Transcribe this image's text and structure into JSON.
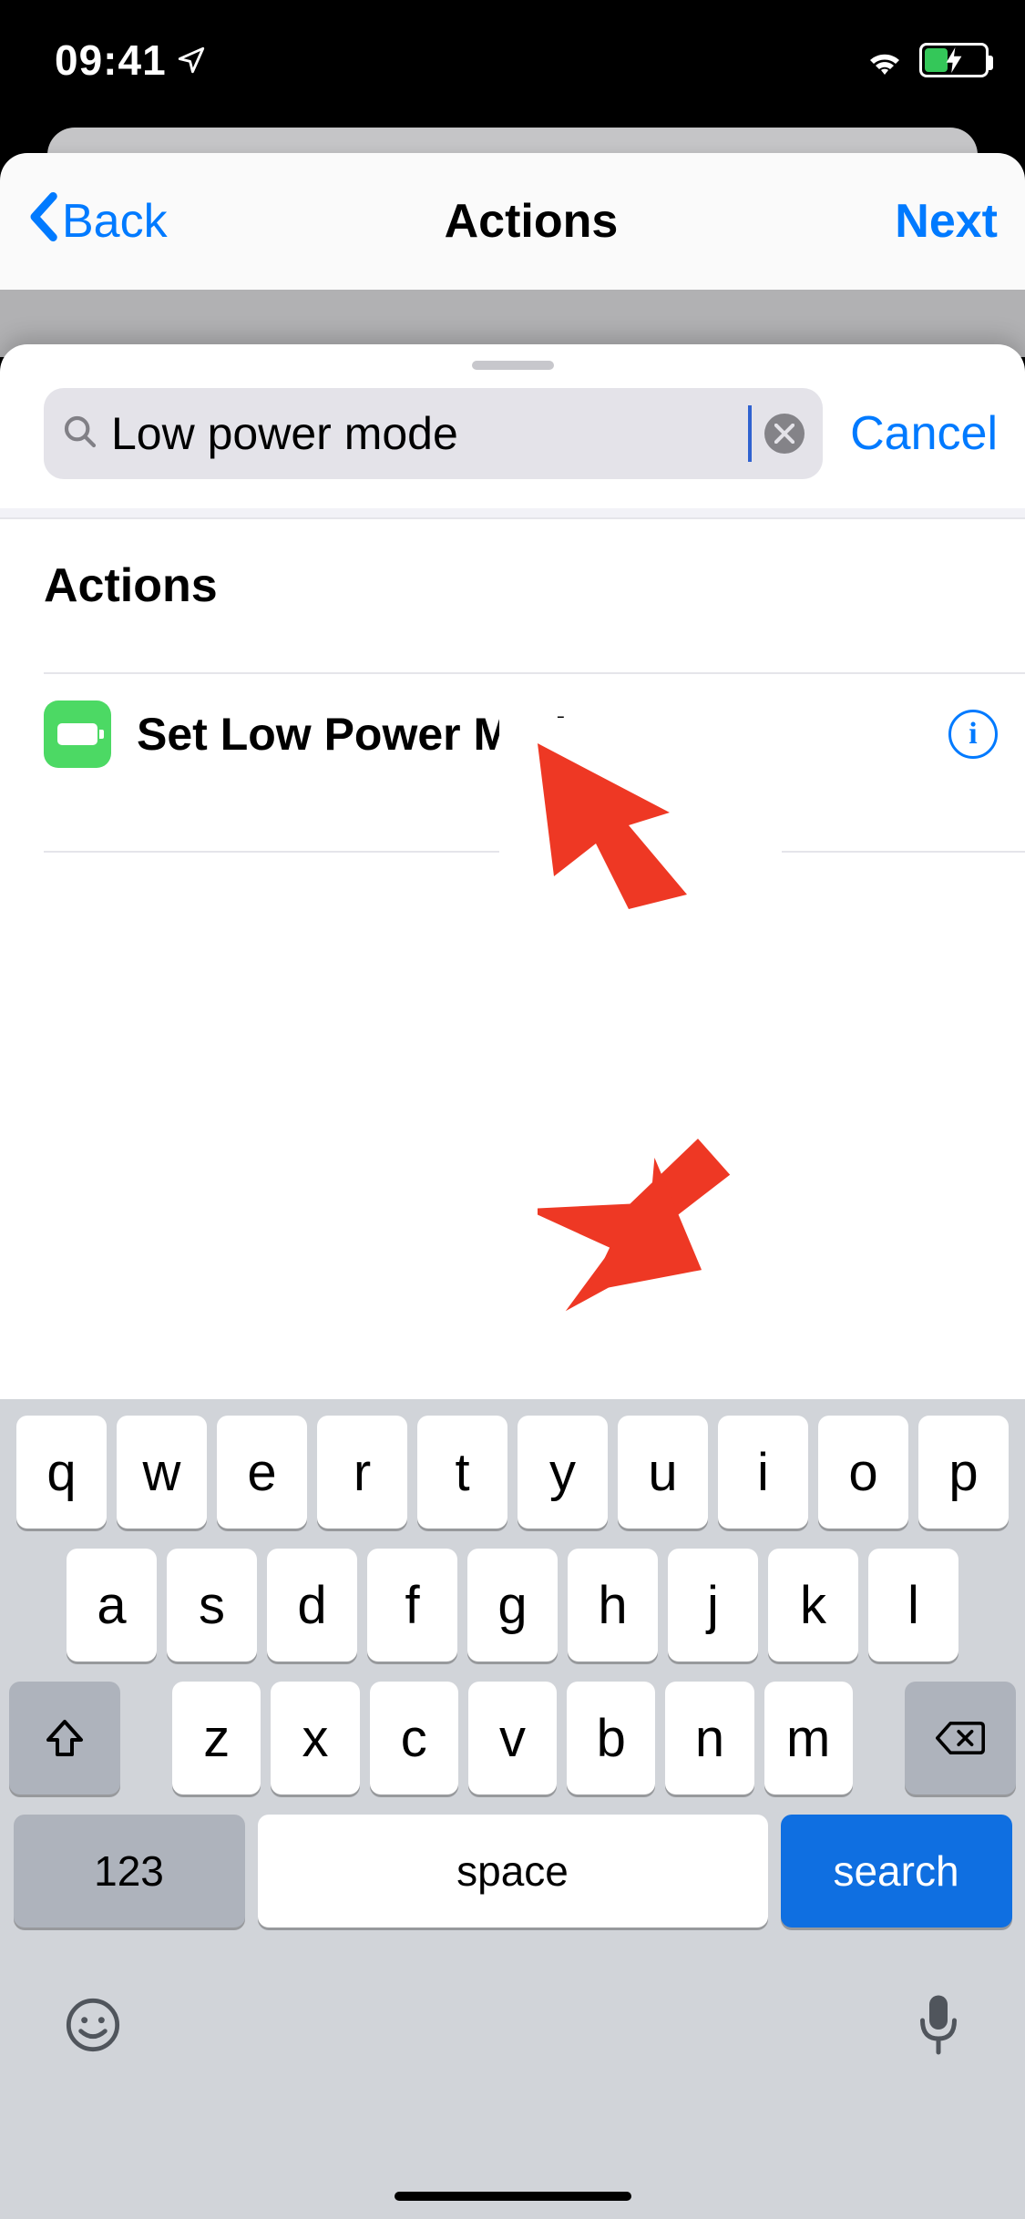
{
  "status": {
    "time": "09:41"
  },
  "nav": {
    "back_label": "Back",
    "title": "Actions",
    "next_label": "Next"
  },
  "search": {
    "value": "Low power mode",
    "cancel_label": "Cancel"
  },
  "results": {
    "section_title": "Actions",
    "items": [
      {
        "label": "Set Low Power Mode",
        "icon": "battery-icon",
        "icon_color": "#4cd964"
      }
    ]
  },
  "keyboard": {
    "row1": [
      "q",
      "w",
      "e",
      "r",
      "t",
      "y",
      "u",
      "i",
      "o",
      "p"
    ],
    "row2": [
      "a",
      "s",
      "d",
      "f",
      "g",
      "h",
      "j",
      "k",
      "l"
    ],
    "row3": [
      "z",
      "x",
      "c",
      "v",
      "b",
      "n",
      "m"
    ],
    "numbers_label": "123",
    "space_label": "space",
    "action_label": "search"
  }
}
